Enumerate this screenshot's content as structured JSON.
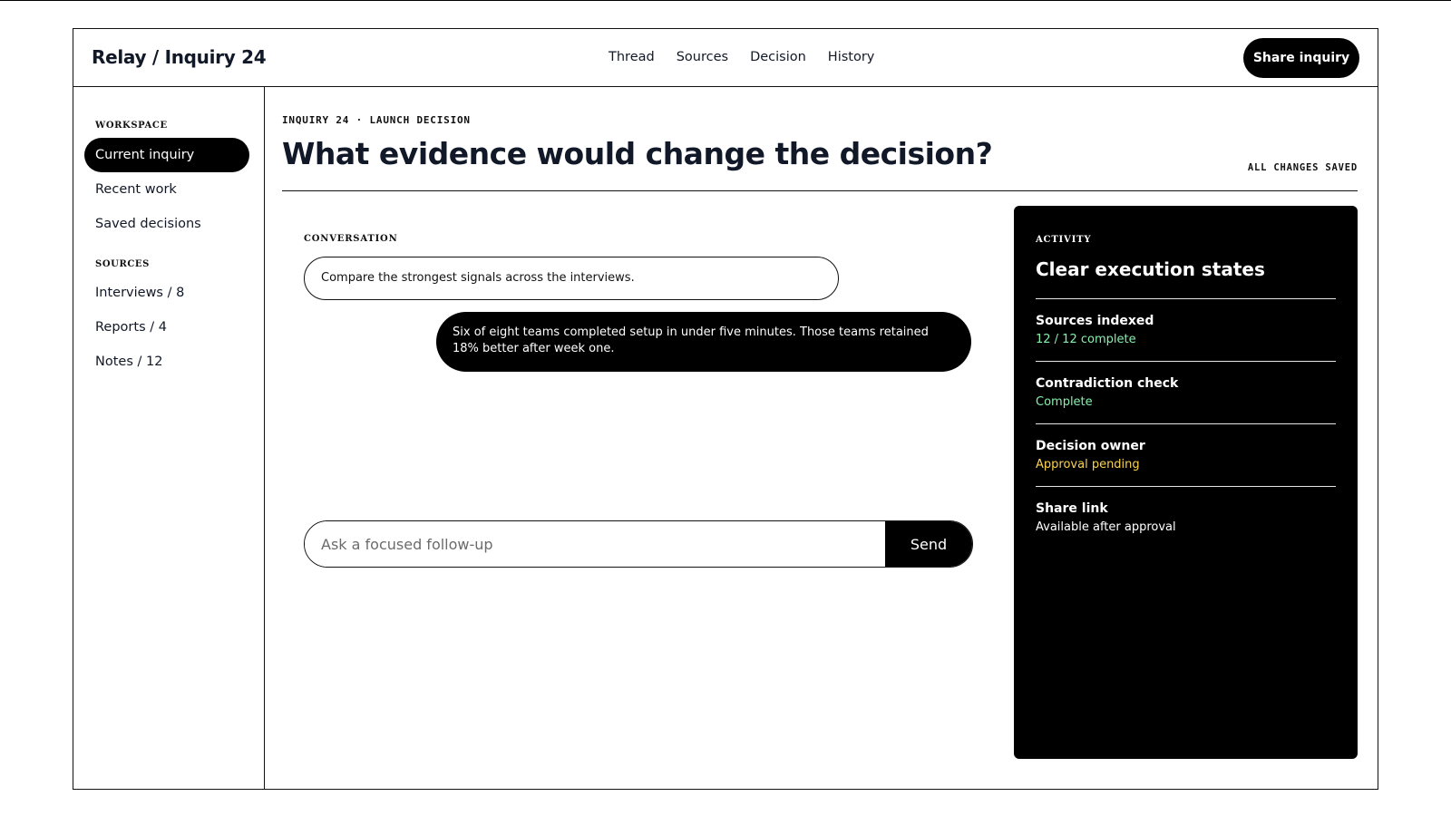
{
  "header": {
    "brand": "Relay / Inquiry 24",
    "nav": [
      "Thread",
      "Sources",
      "Decision",
      "History"
    ],
    "share_label": "Share inquiry"
  },
  "sidebar": {
    "workspace_label": "WORKSPACE",
    "workspace_items": [
      "Current inquiry",
      "Recent work",
      "Saved decisions"
    ],
    "sources_label": "SOURCES",
    "source_items": [
      "Interviews / 8",
      "Reports / 4",
      "Notes / 12"
    ]
  },
  "main": {
    "eyebrow": "INQUIRY 24 · LAUNCH DECISION",
    "title": "What evidence would change the decision?",
    "saved_status": "ALL CHANGES SAVED",
    "conversation_label": "CONVERSATION",
    "messages": {
      "user": "Compare the strongest signals across the interviews.",
      "assistant": "Six of eight teams completed setup in under five minutes. Those teams retained 18% better after week one."
    },
    "composer": {
      "placeholder": "Ask a focused follow-up",
      "value": "",
      "send_label": "Send"
    }
  },
  "activity": {
    "label": "ACTIVITY",
    "title": "Clear execution states",
    "items": [
      {
        "name": "Sources indexed",
        "status": "12 / 12 complete",
        "color": "#86efac"
      },
      {
        "name": "Contradiction check",
        "status": "Complete",
        "color": "#86efac"
      },
      {
        "name": "Decision owner",
        "status": "Approval pending",
        "color": "#fcd34d"
      },
      {
        "name": "Share link",
        "status": "Available after approval",
        "color": "#ffffff"
      }
    ]
  }
}
